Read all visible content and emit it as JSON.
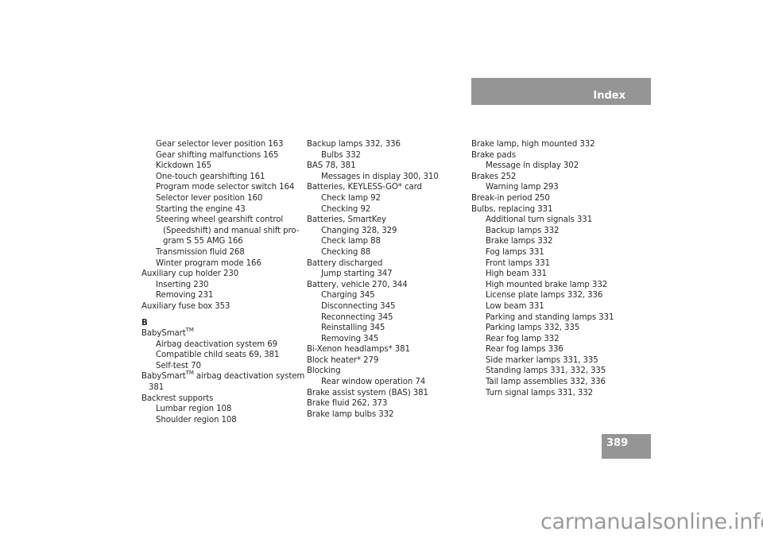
{
  "header": {
    "title": "Index"
  },
  "page_number": "389",
  "columns": [
    {
      "entries": [
        {
          "text": "Gear selector lever position 163",
          "level": 1
        },
        {
          "text": "Gear shifting malfunctions 165",
          "level": 1
        },
        {
          "text": "Kickdown 165",
          "level": 1
        },
        {
          "text": "One-touch gearshifting 161",
          "level": 1
        },
        {
          "text": "Program mode selector switch 164",
          "level": 1
        },
        {
          "text": "Selector lever position 160",
          "level": 1
        },
        {
          "text": "Starting the engine 43",
          "level": 1
        },
        {
          "text": "Steering wheel gearshift control",
          "level": 1
        },
        {
          "text": "(Speedshift) and manual shift pro-",
          "level": 2
        },
        {
          "text": "gram S 55 AMG 166",
          "level": 2
        },
        {
          "text": "Transmission fluid 268",
          "level": 1
        },
        {
          "text": "Winter program mode 166",
          "level": 1
        },
        {
          "text": "Auxiliary cup holder 230",
          "level": 0
        },
        {
          "text": "Inserting 230",
          "level": 1
        },
        {
          "text": "Removing 231",
          "level": 1
        },
        {
          "text": "Auxiliary fuse box 353",
          "level": 0
        },
        {
          "text": "B",
          "level": "letter"
        },
        {
          "text": "BabySmart",
          "sup": "TM",
          "level": 0
        },
        {
          "text": "Airbag deactivation system 69",
          "level": 1
        },
        {
          "text": "Compatible child seats 69, 381",
          "level": 1
        },
        {
          "text": "Self-test 70",
          "level": 1
        },
        {
          "text": "BabySmart",
          "sup": "TM",
          "after": " airbag deactivation system",
          "level": 0
        },
        {
          "text": "381",
          "level": "cont0"
        },
        {
          "text": "Backrest supports",
          "level": 0
        },
        {
          "text": "Lumbar region 108",
          "level": 1
        },
        {
          "text": "Shoulder region 108",
          "level": 1
        }
      ]
    },
    {
      "entries": [
        {
          "text": "Backup lamps 332, 336",
          "level": 0
        },
        {
          "text": "Bulbs 332",
          "level": 1
        },
        {
          "text": "BAS 78, 381",
          "level": 0
        },
        {
          "text": "Messages in display 300, 310",
          "level": 1
        },
        {
          "text": "Batteries, KEYLESS-GO* card",
          "level": 0
        },
        {
          "text": "Check lamp 92",
          "level": 1
        },
        {
          "text": "Checking 92",
          "level": 1
        },
        {
          "text": "Batteries, SmartKey",
          "level": 0
        },
        {
          "text": "Changing 328, 329",
          "level": 1
        },
        {
          "text": "Check lamp 88",
          "level": 1
        },
        {
          "text": "Checking 88",
          "level": 1
        },
        {
          "text": "Battery discharged",
          "level": 0
        },
        {
          "text": "Jump starting 347",
          "level": 1
        },
        {
          "text": "Battery, vehicle 270, 344",
          "level": 0
        },
        {
          "text": "Charging 345",
          "level": 1
        },
        {
          "text": "Disconnecting 345",
          "level": 1
        },
        {
          "text": "Reconnecting 345",
          "level": 1
        },
        {
          "text": "Reinstalling 345",
          "level": 1
        },
        {
          "text": "Removing 345",
          "level": 1
        },
        {
          "text": "Bi-Xenon headlamps* 381",
          "level": 0
        },
        {
          "text": "Block heater* 279",
          "level": 0
        },
        {
          "text": "Blocking",
          "level": 0
        },
        {
          "text": "Rear window operation 74",
          "level": 1
        },
        {
          "text": "Brake assist system (BAS) 381",
          "level": 0
        },
        {
          "text": "Brake fluid 262, 373",
          "level": 0
        },
        {
          "text": "Brake lamp bulbs 332",
          "level": 0
        }
      ]
    },
    {
      "entries": [
        {
          "text": "Brake lamp, high mounted 332",
          "level": 0
        },
        {
          "text": "Brake pads",
          "level": 0
        },
        {
          "text": "Message in display 302",
          "level": 1
        },
        {
          "text": "Brakes 252",
          "level": 0
        },
        {
          "text": "Warning lamp 293",
          "level": 1
        },
        {
          "text": "Break-in period 250",
          "level": 0
        },
        {
          "text": "Bulbs, replacing 331",
          "level": 0
        },
        {
          "text": "Additional turn signals 331",
          "level": 1
        },
        {
          "text": "Backup lamps 332",
          "level": 1
        },
        {
          "text": "Brake lamps 332",
          "level": 1
        },
        {
          "text": "Fog lamps 331",
          "level": 1
        },
        {
          "text": "Front lamps 331",
          "level": 1
        },
        {
          "text": "High beam 331",
          "level": 1
        },
        {
          "text": "High mounted brake lamp 332",
          "level": 1
        },
        {
          "text": "License plate lamps 332, 336",
          "level": 1
        },
        {
          "text": "Low beam 331",
          "level": 1
        },
        {
          "text": "Parking and standing lamps 331",
          "level": 1
        },
        {
          "text": "Parking lamps 332, 335",
          "level": 1
        },
        {
          "text": "Rear fog lamp 332",
          "level": 1
        },
        {
          "text": "Rear fog lamps 336",
          "level": 1
        },
        {
          "text": "Side marker lamps 331, 335",
          "level": 1
        },
        {
          "text": "Standing lamps 331, 332, 335",
          "level": 1
        },
        {
          "text": "Tail lamp assemblies 332, 336",
          "level": 1
        },
        {
          "text": "Turn signal lamps 331, 332",
          "level": 1
        }
      ]
    }
  ],
  "watermark": "carmanualsonline.info",
  "colors": {
    "header_bg": "#959595",
    "header_text": "#ffffff",
    "body_text": "#2a2a2a",
    "watermark": "#9a9a9a"
  }
}
